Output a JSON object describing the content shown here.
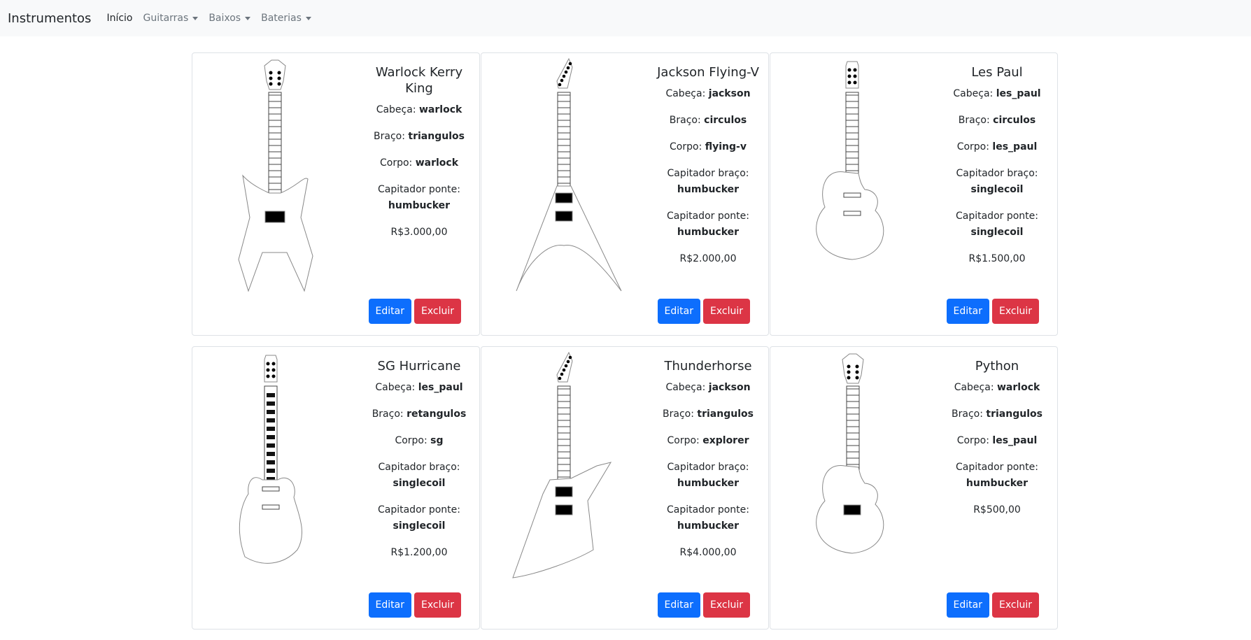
{
  "navbar": {
    "brand": "Instrumentos",
    "links": [
      {
        "label": "Início"
      },
      {
        "label": "Guitarras"
      },
      {
        "label": "Baixos"
      },
      {
        "label": "Baterias"
      }
    ]
  },
  "colors": {
    "edit": "#0d6efd",
    "delete": "#dc3545",
    "navbar_bg": "#f8f9fa"
  },
  "cards": [
    {
      "title": "Warlock Kerry King",
      "specs": [
        {
          "label": "Cabeça:",
          "value": "warlock"
        },
        {
          "label": "Braço:",
          "value": "triangulos"
        },
        {
          "label": "Corpo:",
          "value": "warlock"
        },
        {
          "label": "Capitador ponte:",
          "value": "humbucker"
        }
      ],
      "price": "R$3.000,00",
      "edit_label": "Editar",
      "delete_label": "Excluir"
    },
    {
      "title": "Jackson Flying-V",
      "specs": [
        {
          "label": "Cabeça:",
          "value": "jackson"
        },
        {
          "label": "Braço:",
          "value": "circulos"
        },
        {
          "label": "Corpo:",
          "value": "flying-v"
        },
        {
          "label": "Capitador braço:",
          "value": "humbucker"
        },
        {
          "label": "Capitador ponte:",
          "value": "humbucker"
        }
      ],
      "price": "R$2.000,00",
      "edit_label": "Editar",
      "delete_label": "Excluir"
    },
    {
      "title": "Les Paul",
      "specs": [
        {
          "label": "Cabeça:",
          "value": "les_paul"
        },
        {
          "label": "Braço:",
          "value": "circulos"
        },
        {
          "label": "Corpo:",
          "value": "les_paul"
        },
        {
          "label": "Capitador braço:",
          "value": "singlecoil"
        },
        {
          "label": "Capitador ponte:",
          "value": "singlecoil"
        }
      ],
      "price": "R$1.500,00",
      "edit_label": "Editar",
      "delete_label": "Excluir"
    },
    {
      "title": "SG Hurricane",
      "specs": [
        {
          "label": "Cabeça:",
          "value": "les_paul"
        },
        {
          "label": "Braço:",
          "value": "retangulos"
        },
        {
          "label": "Corpo:",
          "value": "sg"
        },
        {
          "label": "Capitador braço:",
          "value": "singlecoil"
        },
        {
          "label": "Capitador ponte:",
          "value": "singlecoil"
        }
      ],
      "price": "R$1.200,00",
      "edit_label": "Editar",
      "delete_label": "Excluir"
    },
    {
      "title": "Thunderhorse",
      "specs": [
        {
          "label": "Cabeça:",
          "value": "jackson"
        },
        {
          "label": "Braço:",
          "value": "triangulos"
        },
        {
          "label": "Corpo:",
          "value": "explorer"
        },
        {
          "label": "Capitador braço:",
          "value": "humbucker"
        },
        {
          "label": "Capitador ponte:",
          "value": "humbucker"
        }
      ],
      "price": "R$4.000,00",
      "edit_label": "Editar",
      "delete_label": "Excluir"
    },
    {
      "title": "Python",
      "specs": [
        {
          "label": "Cabeça:",
          "value": "warlock"
        },
        {
          "label": "Braço:",
          "value": "triangulos"
        },
        {
          "label": "Corpo:",
          "value": "les_paul"
        },
        {
          "label": "Capitador ponte:",
          "value": "humbucker"
        }
      ],
      "price": "R$500,00",
      "edit_label": "Editar",
      "delete_label": "Excluir"
    }
  ]
}
